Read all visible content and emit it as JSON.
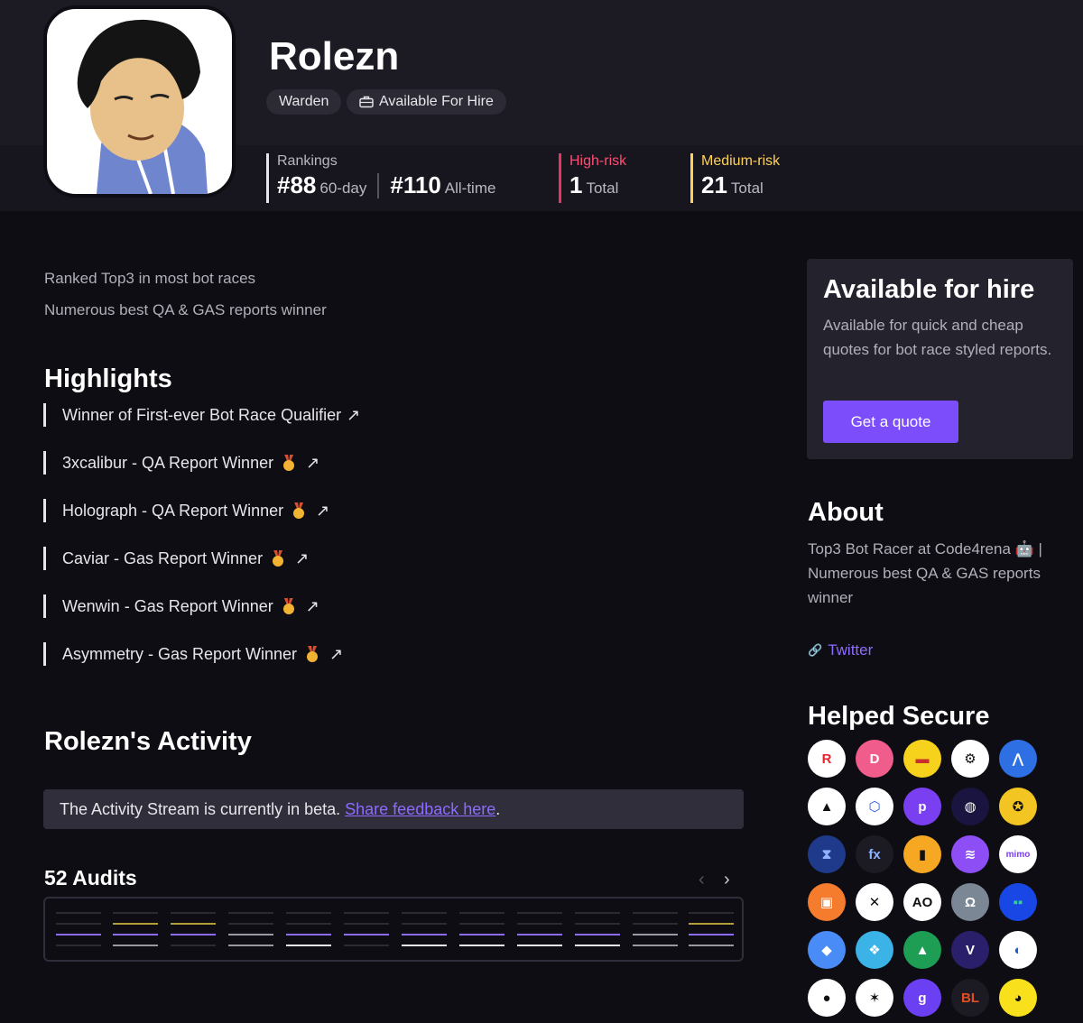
{
  "profile": {
    "name": "Rolezn",
    "role_badge": "Warden",
    "hire_badge": "Available For Hire"
  },
  "stats": {
    "rankings_label": "Rankings",
    "rank_60": "#88",
    "rank_60_suffix": "60-day",
    "rank_all": "#110",
    "rank_all_suffix": "All-time",
    "high_label": "High-risk",
    "high_value": "1",
    "high_suffix": "Total",
    "med_label": "Medium-risk",
    "med_value": "21",
    "med_suffix": "Total"
  },
  "bio": [
    "Ranked Top3 in most bot races",
    "Numerous best QA & GAS reports winner"
  ],
  "highlights": {
    "title": "Highlights",
    "items": [
      {
        "label": "Winner of First-ever Bot Race Qualifier",
        "medal": false
      },
      {
        "label": "3xcalibur - QA Report Winner",
        "medal": true
      },
      {
        "label": "Holograph - QA Report Winner",
        "medal": true
      },
      {
        "label": "Caviar - Gas Report Winner",
        "medal": true
      },
      {
        "label": "Wenwin - Gas Report Winner",
        "medal": true
      },
      {
        "label": "Asymmetry - Gas Report Winner",
        "medal": true
      }
    ]
  },
  "activity": {
    "title": "Rolezn's Activity",
    "beta_text": "The Activity Stream is currently in beta.",
    "beta_link": "Share feedback here",
    "beta_end": ".",
    "audits_title": "52 Audits"
  },
  "hire": {
    "title": "Available for hire",
    "text": "Available for quick and cheap quotes for bot race styled reports.",
    "button": "Get a quote"
  },
  "about": {
    "title": "About",
    "text": "Top3 Bot Racer at Code4rena 🤖 | Numerous best QA & GAS reports winner",
    "twitter": "Twitter"
  },
  "secure": {
    "title": "Helped Secure",
    "logos": [
      {
        "bg": "#ffffff",
        "fg": "#e5252c",
        "glyph": "R"
      },
      {
        "bg": "#f05c8c",
        "fg": "#ffffff",
        "glyph": "D"
      },
      {
        "bg": "#f6d21c",
        "fg": "#c9302c",
        "glyph": "▬"
      },
      {
        "bg": "#ffffff",
        "fg": "#111111",
        "glyph": "⚙"
      },
      {
        "bg": "#2f6fe4",
        "fg": "#ffffff",
        "glyph": "⋀"
      },
      {
        "bg": "#ffffff",
        "fg": "#111111",
        "glyph": "▲"
      },
      {
        "bg": "#ffffff",
        "fg": "#2a5ada",
        "glyph": "⬡"
      },
      {
        "bg": "#7b3ff2",
        "fg": "#ffffff",
        "glyph": "p"
      },
      {
        "bg": "#1a1440",
        "fg": "#ffffff",
        "glyph": "◍"
      },
      {
        "bg": "#f3c522",
        "fg": "#111111",
        "glyph": "✪"
      },
      {
        "bg": "#1f3a8a",
        "fg": "#8fb2ff",
        "glyph": "⧗"
      },
      {
        "bg": "#1c1b24",
        "fg": "#8fb2ff",
        "glyph": "fx"
      },
      {
        "bg": "#f7a822",
        "fg": "#111111",
        "glyph": "▮"
      },
      {
        "bg": "#8d4ff5",
        "fg": "#ffffff",
        "glyph": "≋"
      },
      {
        "bg": "#ffffff",
        "fg": "#7b3ff2",
        "glyph": "mimo"
      },
      {
        "bg": "#f47c2c",
        "fg": "#ffffff",
        "glyph": "▣"
      },
      {
        "bg": "#ffffff",
        "fg": "#111111",
        "glyph": "✕"
      },
      {
        "bg": "#ffffff",
        "fg": "#111111",
        "glyph": "AO"
      },
      {
        "bg": "#7b8794",
        "fg": "#ffffff",
        "glyph": "Ω"
      },
      {
        "bg": "#1947e5",
        "fg": "#32d296",
        "glyph": "▪▪"
      },
      {
        "bg": "#4a8cf7",
        "fg": "#ffffff",
        "glyph": "◆"
      },
      {
        "bg": "#3bb3e6",
        "fg": "#ffffff",
        "glyph": "❖"
      },
      {
        "bg": "#1e9e55",
        "fg": "#ffffff",
        "glyph": "▲"
      },
      {
        "bg": "#2a1f6b",
        "fg": "#ffffff",
        "glyph": "V"
      },
      {
        "bg": "#ffffff",
        "fg": "#1f5fc9",
        "glyph": "◐"
      },
      {
        "bg": "#ffffff",
        "fg": "#111111",
        "glyph": "●"
      },
      {
        "bg": "#ffffff",
        "fg": "#111111",
        "glyph": "✶"
      },
      {
        "bg": "#6b3ff2",
        "fg": "#ffffff",
        "glyph": "g"
      },
      {
        "bg": "#1c1b24",
        "fg": "#e24d22",
        "glyph": "BL"
      },
      {
        "bg": "#f8e11c",
        "fg": "#111111",
        "glyph": "◕"
      }
    ]
  }
}
